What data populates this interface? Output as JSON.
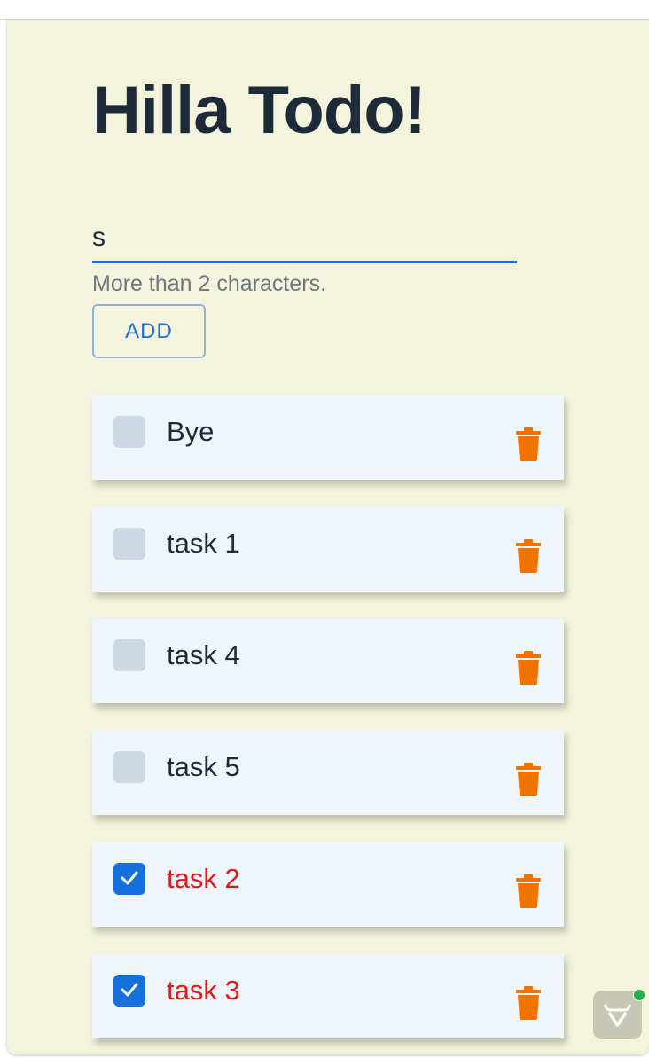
{
  "app": {
    "title": "Hilla Todo!"
  },
  "form": {
    "input_value": "s",
    "helper_text": "More than 2 characters.",
    "add_label": "ADD"
  },
  "todos": [
    {
      "task": "Bye",
      "done": false
    },
    {
      "task": "task 1",
      "done": false
    },
    {
      "task": "task 4",
      "done": false
    },
    {
      "task": "task 5",
      "done": false
    },
    {
      "task": "task 2",
      "done": true
    },
    {
      "task": "task 3",
      "done": true
    }
  ],
  "icons": {
    "delete": "trash-icon",
    "check": "check-icon",
    "dev_tools": "vaadin-logo-icon"
  },
  "colors": {
    "background": "#f4f4dc",
    "accent": "#1f6fd1",
    "delete_icon": "#f07300",
    "done_text": "#e21818",
    "status_dot": "#22b24c"
  }
}
